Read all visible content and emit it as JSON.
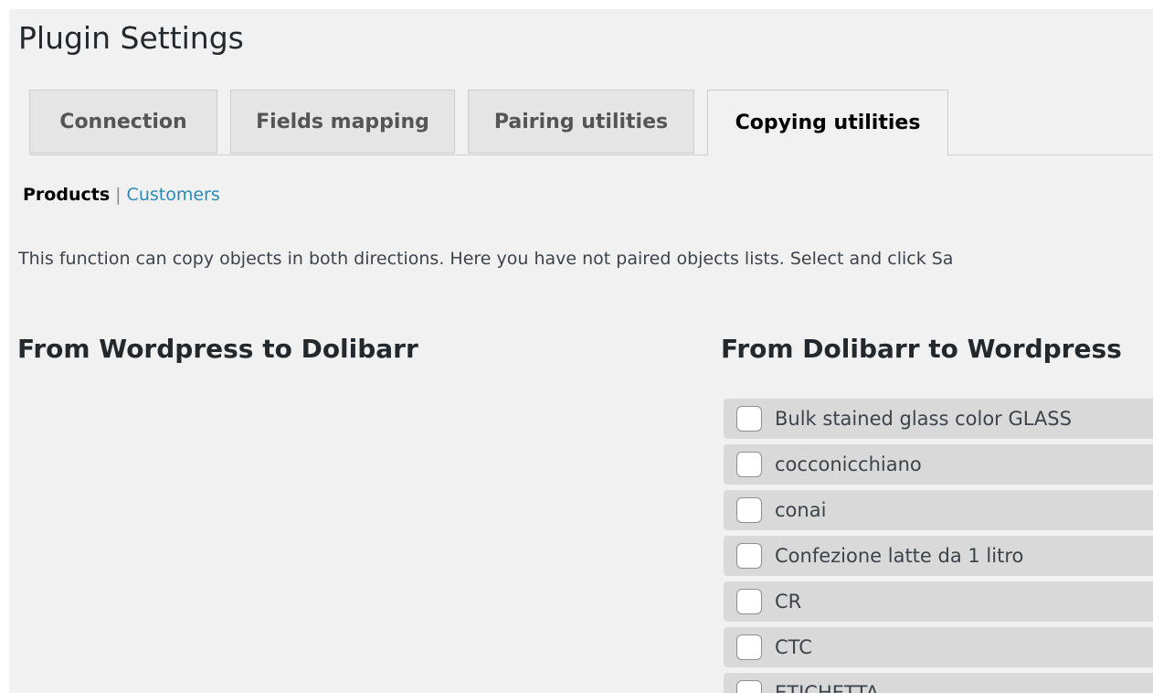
{
  "page": {
    "title": "Plugin Settings"
  },
  "tabs": [
    {
      "label": "Connection",
      "active": false
    },
    {
      "label": "Fields mapping",
      "active": false
    },
    {
      "label": "Pairing utilities",
      "active": false
    },
    {
      "label": "Copying utilities",
      "active": true
    }
  ],
  "subnav": {
    "current": "Products",
    "separator": "|",
    "link": "Customers"
  },
  "description": "This function can copy objects in both directions. Here you have not paired objects lists. Select and click Sa",
  "sections": {
    "left_heading": "From Wordpress to Dolibarr",
    "right_heading": "From Dolibarr to Wordpress"
  },
  "dolibarr_objects": [
    {
      "label": "Bulk stained glass color GLASS",
      "checked": false
    },
    {
      "label": "cocconicchiano",
      "checked": false
    },
    {
      "label": "conai",
      "checked": false
    },
    {
      "label": "Confezione latte da 1 litro",
      "checked": false
    },
    {
      "label": "CR",
      "checked": false
    },
    {
      "label": "CTC",
      "checked": false
    },
    {
      "label": "ETICHETTA",
      "checked": false
    }
  ],
  "colors": {
    "link": "#2a8bb8",
    "background": "#f1f1f1",
    "list_item_bg": "#d9d9d9"
  }
}
